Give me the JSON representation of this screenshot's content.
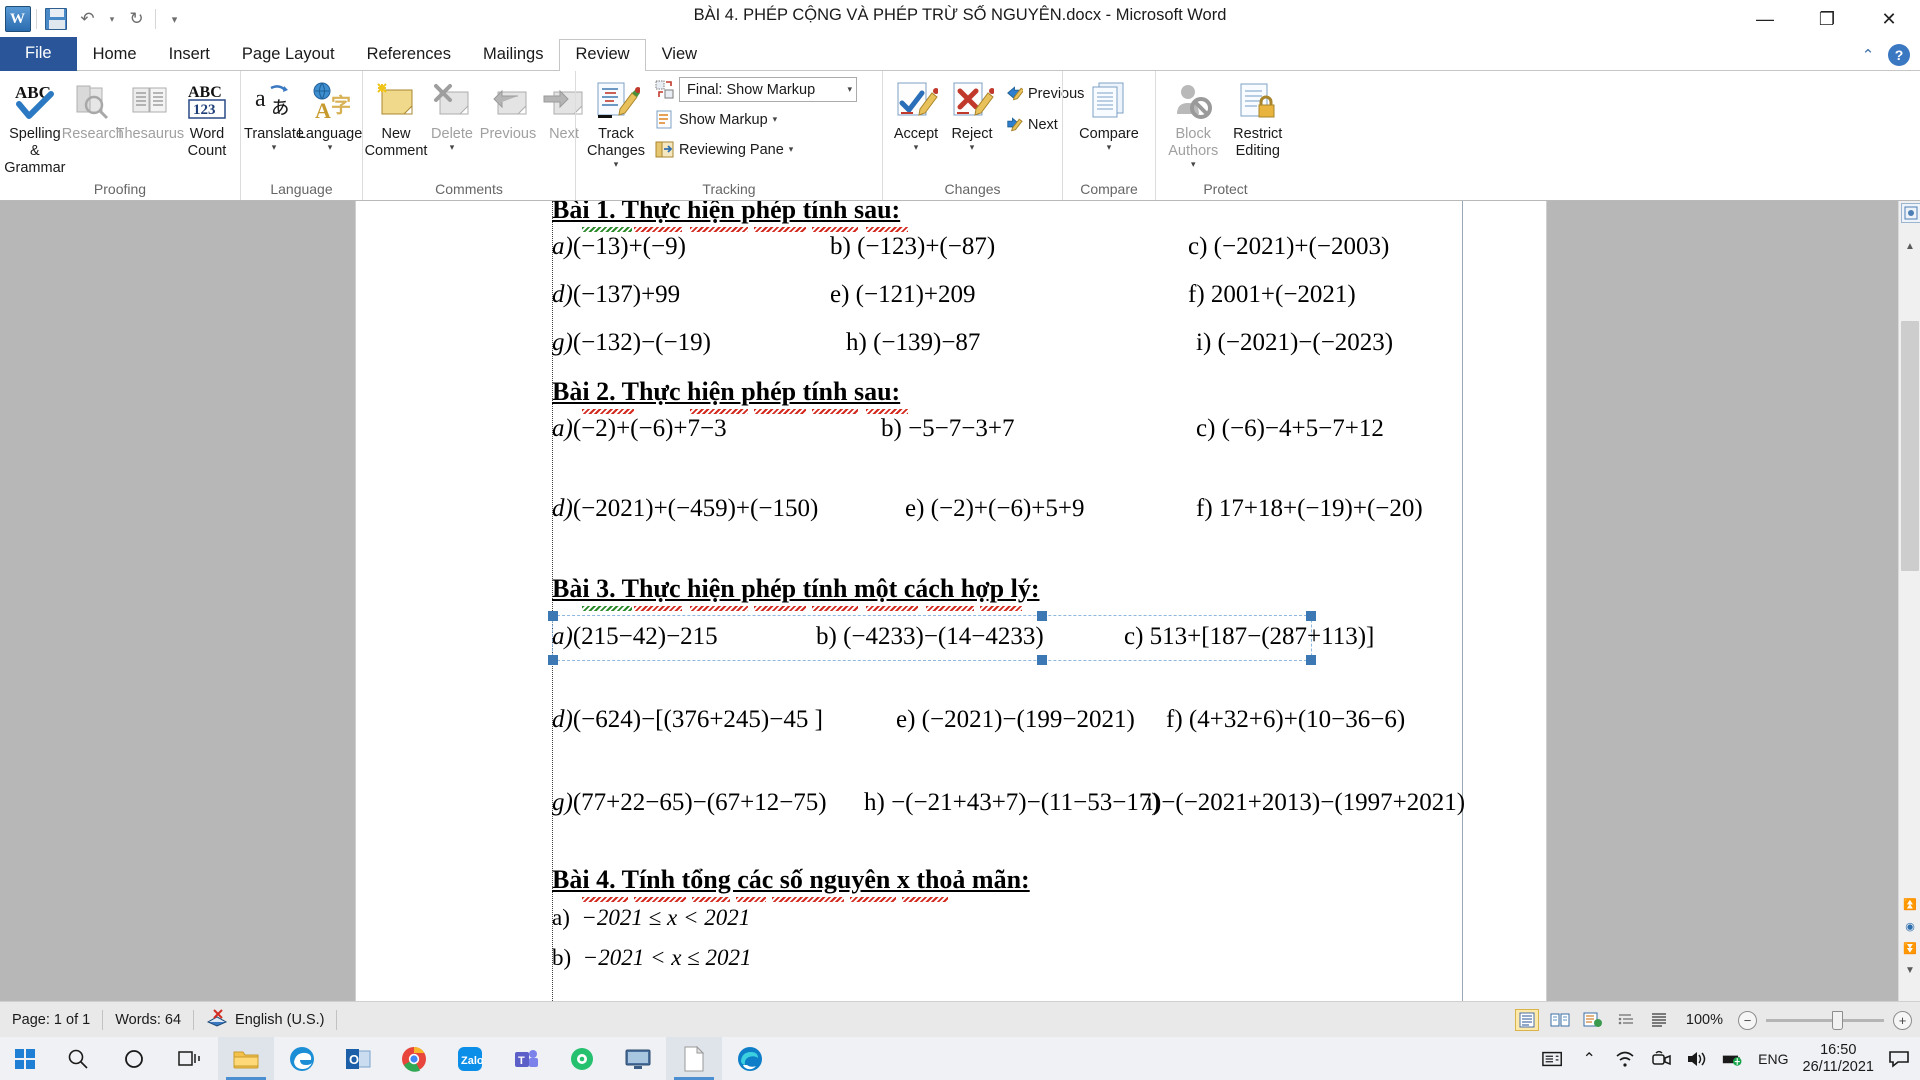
{
  "titlebar": {
    "document_title": "BÀI 4. PHÉP CỘNG VÀ PHÉP TRỪ SỐ NGUYÊN.docx  -  Microsoft Word",
    "qat": [
      {
        "name": "word-logo",
        "label": "W"
      },
      {
        "name": "save-icon",
        "label": "Save"
      },
      {
        "name": "undo-icon",
        "label": "↶"
      },
      {
        "name": "undo-dropdown",
        "label": "▾"
      },
      {
        "name": "redo-icon",
        "label": "↻"
      },
      {
        "name": "customize-qat",
        "label": "▾"
      }
    ],
    "window_controls": {
      "minimize": "—",
      "restore": "❐",
      "close": "✕"
    }
  },
  "tabs": [
    {
      "label": "File",
      "active": false,
      "file": true
    },
    {
      "label": "Home",
      "active": false
    },
    {
      "label": "Insert",
      "active": false
    },
    {
      "label": "Page Layout",
      "active": false
    },
    {
      "label": "References",
      "active": false
    },
    {
      "label": "Mailings",
      "active": false
    },
    {
      "label": "Review",
      "active": true
    },
    {
      "label": "View",
      "active": false
    }
  ],
  "ribbon": {
    "groups": [
      {
        "name": "proofing",
        "label": "Proofing",
        "buttons": [
          {
            "name": "spelling-grammar",
            "label": "Spelling &\nGrammar",
            "icon": "abc-check-icon",
            "disabled": false
          },
          {
            "name": "research",
            "label": "Research",
            "icon": "research-icon",
            "disabled": true
          },
          {
            "name": "thesaurus",
            "label": "Thesaurus",
            "icon": "thesaurus-icon",
            "disabled": true
          },
          {
            "name": "word-count",
            "label": "Word\nCount",
            "icon": "abc-123-icon",
            "disabled": false
          }
        ]
      },
      {
        "name": "language",
        "label": "Language",
        "buttons": [
          {
            "name": "translate",
            "label": "Translate",
            "icon": "translate-icon",
            "caret": true
          },
          {
            "name": "language",
            "label": "Language",
            "icon": "language-globe-icon",
            "caret": true
          }
        ]
      },
      {
        "name": "comments",
        "label": "Comments",
        "buttons": [
          {
            "name": "new-comment",
            "label": "New\nComment",
            "icon": "new-comment-icon",
            "disabled": false
          },
          {
            "name": "delete-comment",
            "label": "Delete",
            "icon": "delete-comment-icon",
            "disabled": true,
            "caret": true
          },
          {
            "name": "previous-comment",
            "label": "Previous",
            "icon": "previous-comment-icon",
            "disabled": true
          },
          {
            "name": "next-comment",
            "label": "Next",
            "icon": "next-comment-icon",
            "disabled": true
          }
        ]
      },
      {
        "name": "tracking",
        "label": "Tracking",
        "buttons": [
          {
            "name": "track-changes",
            "label": "Track\nChanges",
            "icon": "track-changes-icon",
            "caret": true
          }
        ],
        "small_items": [
          {
            "name": "display-for-review-dropdown",
            "label": "Final: Show Markup",
            "icon": "display-review-icon",
            "combo": true
          },
          {
            "name": "show-markup-menu",
            "label": "Show Markup",
            "icon": "show-markup-icon",
            "caret": true
          },
          {
            "name": "reviewing-pane-menu",
            "label": "Reviewing Pane",
            "icon": "reviewing-pane-icon",
            "caret": true
          }
        ]
      },
      {
        "name": "changes",
        "label": "Changes",
        "buttons": [
          {
            "name": "accept-change",
            "label": "Accept",
            "icon": "accept-icon",
            "caret": true
          },
          {
            "name": "reject-change",
            "label": "Reject",
            "icon": "reject-icon",
            "caret": true
          }
        ],
        "small_items": [
          {
            "name": "previous-change",
            "label": "Previous",
            "icon": "previous-change-icon"
          },
          {
            "name": "next-change",
            "label": "Next",
            "icon": "next-change-icon"
          }
        ]
      },
      {
        "name": "compare",
        "label": "Compare",
        "buttons": [
          {
            "name": "compare-documents",
            "label": "Compare",
            "icon": "compare-icon",
            "caret": true
          }
        ]
      },
      {
        "name": "protect",
        "label": "Protect",
        "buttons": [
          {
            "name": "block-authors",
            "label": "Block\nAuthors",
            "icon": "block-authors-icon",
            "disabled": true,
            "caret": true
          },
          {
            "name": "restrict-editing",
            "label": "Restrict\nEditing",
            "icon": "restrict-editing-icon",
            "disabled": false
          }
        ]
      }
    ]
  },
  "document": {
    "blocks": [
      {
        "type": "heading",
        "name": "bai-1-heading",
        "text": "Bài 1. Thực hiện phép tính sau:"
      },
      {
        "type": "row",
        "name": "bai1-row1",
        "cells": [
          {
            "label": "a)",
            "italic": true,
            "expr": "(−13)+(−9)"
          },
          {
            "label": "b)",
            "italic": false,
            "expr": "(−123)+(−87)"
          },
          {
            "label": "c)",
            "italic": false,
            "expr": "(−2021)+(−2003)"
          }
        ]
      },
      {
        "type": "row",
        "name": "bai1-row2",
        "cells": [
          {
            "label": "d)",
            "italic": true,
            "expr": "(−137)+99"
          },
          {
            "label": "e)",
            "italic": false,
            "expr": "(−121)+209"
          },
          {
            "label": "f)",
            "italic": false,
            "expr": "2001+(−2021)"
          }
        ]
      },
      {
        "type": "row",
        "name": "bai1-row3",
        "cells": [
          {
            "label": "g)",
            "italic": true,
            "expr": "(−132)−(−19)"
          },
          {
            "label": "h)",
            "italic": false,
            "expr": "(−139)−87"
          },
          {
            "label": "i)",
            "italic": false,
            "expr": "(−2021)−(−2023)"
          }
        ]
      },
      {
        "type": "heading",
        "name": "bai-2-heading",
        "text": "Bài 2. Thực hiện phép tính sau:"
      },
      {
        "type": "row",
        "name": "bai2-row1",
        "cells": [
          {
            "label": "a)",
            "italic": true,
            "expr": "(−2)+(−6)+7−3"
          },
          {
            "label": "b)",
            "italic": false,
            "expr": "−5−7−3+7"
          },
          {
            "label": "c)",
            "italic": false,
            "expr": "(−6)−4+5−7+12"
          }
        ]
      },
      {
        "type": "row",
        "name": "bai2-row2",
        "cells": [
          {
            "label": "d)",
            "italic": true,
            "expr": "(−2021)+(−459)+(−150)"
          },
          {
            "label": "e)",
            "italic": false,
            "expr": "(−2)+(−6)+5+9"
          },
          {
            "label": "f)",
            "italic": false,
            "expr": "17+18+(−19)+(−20)"
          }
        ]
      },
      {
        "type": "heading",
        "name": "bai-3-heading",
        "text": "Bài 3. Thực hiện phép tính một cách hợp lý:"
      },
      {
        "type": "row",
        "name": "bai3-row1-selected",
        "selected": true,
        "cells": [
          {
            "label": "a)",
            "italic": true,
            "expr": "(215−42)−215"
          },
          {
            "label": "b)",
            "italic": false,
            "expr": "(−4233)−(14−4233)"
          },
          {
            "label": "c)",
            "italic": false,
            "expr": "513+[187−(287+113)]"
          }
        ]
      },
      {
        "type": "row",
        "name": "bai3-row2",
        "cells": [
          {
            "label": "d)",
            "italic": true,
            "expr": "(−624)−[(376+245)−45 ]"
          },
          {
            "label": "e)",
            "italic": false,
            "expr": "(−2021)−(199−2021)"
          },
          {
            "label": "f)",
            "italic": false,
            "expr": "(4+32+6)+(10−36−6)"
          }
        ]
      },
      {
        "type": "row",
        "name": "bai3-row3",
        "cells": [
          {
            "label": "g)",
            "italic": true,
            "expr": "(77+22−65)−(67+12−75)"
          },
          {
            "label": "h)",
            "italic": false,
            "expr": "−(−21+43+7)−(11−53−17)"
          },
          {
            "label": "i)",
            "italic": false,
            "expr": "−(−2021+2013)−(1997+2021)"
          }
        ]
      },
      {
        "type": "heading",
        "name": "bai-4-heading",
        "text": "Bài 4. Tính tổng các số nguyên x thoả mãn:"
      },
      {
        "type": "simple",
        "name": "bai4-item-a",
        "label": "a)",
        "expr": "−2021 ≤ x < 2021"
      },
      {
        "type": "simple",
        "name": "bai4-item-b",
        "label": "b)",
        "expr": "−2021 < x ≤ 2021"
      }
    ]
  },
  "statusbar": {
    "page": "Page: 1 of 1",
    "words": "Words: 64",
    "proofing_icon": "proofing-errors-icon",
    "language": "English (U.S.)",
    "view_buttons": [
      {
        "name": "print-layout-view",
        "selected": true
      },
      {
        "name": "full-screen-reading-view",
        "selected": false
      },
      {
        "name": "web-layout-view",
        "selected": false
      },
      {
        "name": "outline-view",
        "selected": false
      },
      {
        "name": "draft-view",
        "selected": false
      }
    ],
    "zoom": "100%",
    "zoom_out": "−",
    "zoom_in": "+"
  },
  "taskbar": {
    "start": "start-button",
    "items": [
      {
        "name": "search-icon",
        "glyph": "search"
      },
      {
        "name": "cortana-icon",
        "glyph": "circle"
      },
      {
        "name": "task-view-icon",
        "glyph": "taskview"
      },
      {
        "name": "file-explorer-icon",
        "glyph": "folder",
        "active": true
      },
      {
        "name": "edge-legacy-icon",
        "glyph": "e"
      },
      {
        "name": "outlook-icon",
        "glyph": "outlook"
      },
      {
        "name": "chrome-icon",
        "glyph": "chrome"
      },
      {
        "name": "zalo-icon",
        "glyph": "zalo"
      },
      {
        "name": "teams-icon",
        "glyph": "teams"
      },
      {
        "name": "app-green-icon",
        "glyph": "green"
      },
      {
        "name": "ultraviewer-icon",
        "glyph": "monitor"
      },
      {
        "name": "word-document-icon",
        "glyph": "doc",
        "active": true
      },
      {
        "name": "edge-icon",
        "glyph": "edge"
      }
    ],
    "tray": {
      "news_icon": "news-weather-icon",
      "chevron": "show-hidden-icons",
      "network": "network-icon",
      "camera": "camera-icon",
      "volume": "volume-icon",
      "battery": "battery-icon",
      "language": "ENG",
      "time": "16:50",
      "date": "26/11/2021",
      "action_center": "action-center-icon"
    }
  }
}
